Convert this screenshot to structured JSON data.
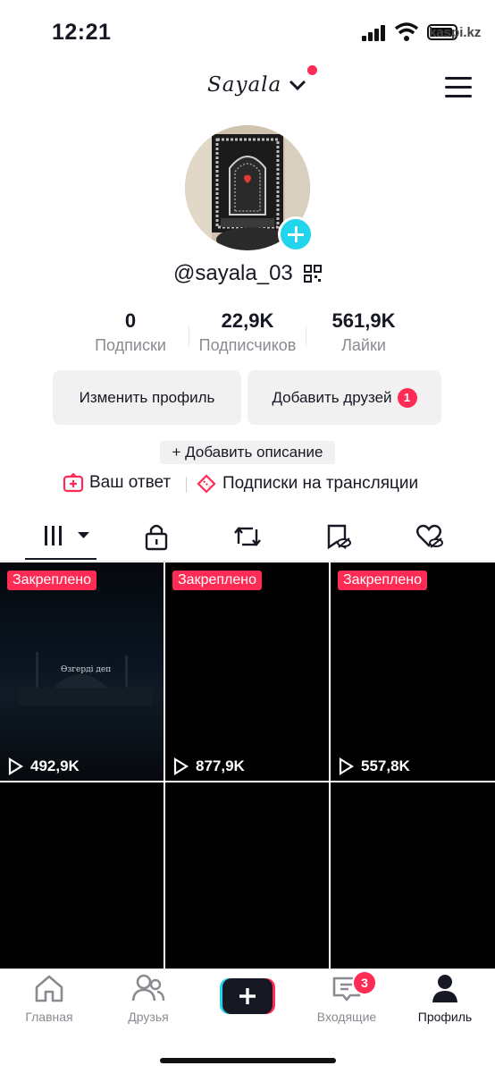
{
  "status_bar": {
    "time": "12:21",
    "watermark": "kaspi.kz"
  },
  "header": {
    "account_name": "Sayala"
  },
  "profile": {
    "username": "@sayala_03"
  },
  "stats": [
    {
      "value": "0",
      "label": "Подписки"
    },
    {
      "value": "22,9K",
      "label": "Подписчиков"
    },
    {
      "value": "561,9K",
      "label": "Лайки"
    }
  ],
  "buttons": {
    "edit_profile": "Изменить профиль",
    "add_friends": "Добавить друзей",
    "add_friends_badge": "1",
    "add_description": "+ Добавить описание"
  },
  "links": {
    "your_answer": "Ваш ответ",
    "live_subscriptions": "Подписки на трансляции"
  },
  "tabs": [
    "videos-grid",
    "private",
    "reposts",
    "saved",
    "liked"
  ],
  "videos": [
    {
      "pinned": "Закреплено",
      "views": "492,9K",
      "overlay": "Өзгерді деп"
    },
    {
      "pinned": "Закреплено",
      "views": "877,9K",
      "overlay": ""
    },
    {
      "pinned": "Закреплено",
      "views": "557,8K",
      "overlay": ""
    },
    {
      "pinned": "",
      "views": "",
      "overlay": ""
    },
    {
      "pinned": "",
      "views": "",
      "overlay": ""
    },
    {
      "pinned": "",
      "views": "",
      "overlay": ""
    }
  ],
  "bottom_nav": {
    "home": "Главная",
    "friends": "Друзья",
    "inbox": "Входящие",
    "inbox_badge": "3",
    "profile": "Профиль"
  },
  "colors": {
    "accent": "#fe2c55",
    "cyan": "#20d5ec",
    "text": "#161823",
    "muted": "#8a8b91",
    "button_bg": "#f1f1f2"
  }
}
